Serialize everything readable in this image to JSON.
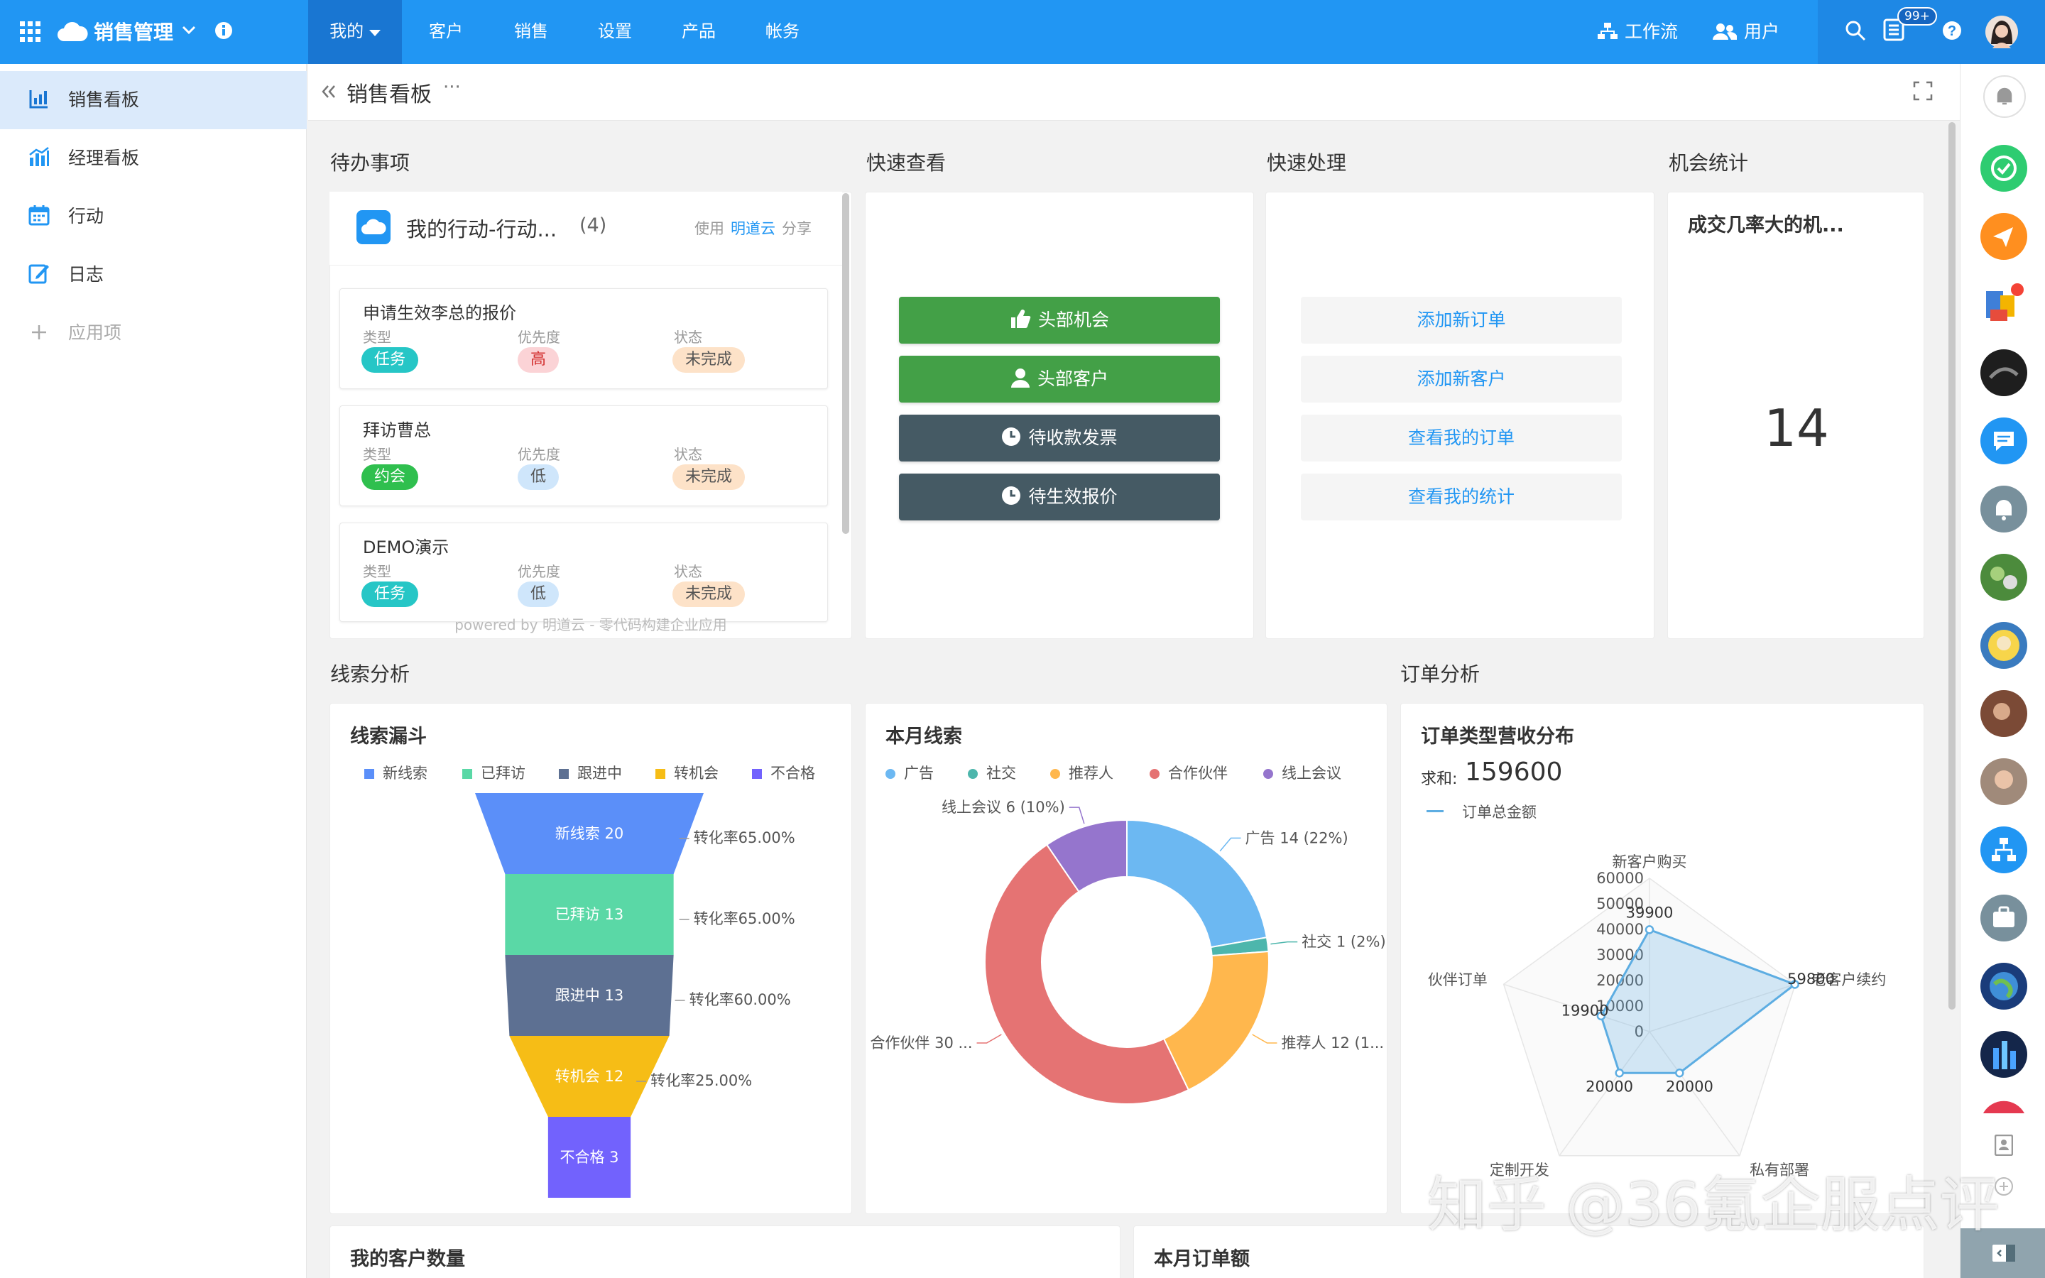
{
  "topbar": {
    "app_name": "销售管理",
    "nav": [
      "我的",
      "客户",
      "销售",
      "设置",
      "产品",
      "帐务"
    ],
    "workflow": "工作流",
    "users": "用户",
    "badge": "99+"
  },
  "sidebar": {
    "items": [
      "销售看板",
      "经理看板",
      "行动",
      "日志"
    ],
    "add_label": "应用项"
  },
  "page": {
    "title": "销售看板",
    "more": "···"
  },
  "todo": {
    "section": "待办事项",
    "card_title": "我的行动-行动...",
    "count": "(4)",
    "share_prefix": "使用",
    "share_brand": "明道云",
    "share_suffix": "分享",
    "labels": {
      "type": "类型",
      "priority": "优先度",
      "status": "状态"
    },
    "tasks": [
      {
        "title": "申请生效李总的报价",
        "type": "任务",
        "priority": "高",
        "status": "未完成"
      },
      {
        "title": "拜访曹总",
        "type": "约会",
        "priority": "低",
        "status": "未完成"
      },
      {
        "title": "DEMO演示",
        "type": "任务",
        "priority": "低",
        "status": "未完成"
      }
    ],
    "powered": "powered by 明道云 - 零代码构建企业应用"
  },
  "quick_view": {
    "section": "快速查看",
    "buttons": [
      "头部机会",
      "头部客户",
      "待收款发票",
      "待生效报价"
    ]
  },
  "quick_handle": {
    "section": "快速处理",
    "buttons": [
      "添加新订单",
      "添加新客户",
      "查看我的订单",
      "查看我的统计"
    ]
  },
  "opportunity": {
    "section": "机会统计",
    "card_title": "成交几率大的机...",
    "value": "14"
  },
  "lead_section": "线索分析",
  "order_section": "订单分析",
  "funnel": {
    "title": "线索漏斗",
    "legend": [
      "新线索",
      "已拜访",
      "跟进中",
      "转机会",
      "不合格"
    ],
    "colors": [
      "#5b8ff9",
      "#5ad8a6",
      "#5d7092",
      "#f6bd16",
      "#7262fd"
    ],
    "stage_labels": [
      "新线索 20",
      "已拜访 13",
      "跟进中 13",
      "转机会 12",
      "不合格 3"
    ],
    "rates": [
      "转化率65.00%",
      "转化率65.00%",
      "转化率60.00%",
      "转化率25.00%"
    ]
  },
  "donut": {
    "title": "本月线索",
    "legend": [
      "广告",
      "社交",
      "推荐人",
      "合作伙伴",
      "线上会议"
    ],
    "colors": [
      "#6cb8f2",
      "#4db6ac",
      "#ffb74d",
      "#e57373",
      "#9575cd"
    ],
    "slice_labels": [
      "广告  14 (22%)",
      "社交  1 (2%)",
      "推荐人  12 (1...",
      "合作伙伴  30 ...",
      "线上会议  6 (10%)"
    ]
  },
  "radar": {
    "title": "订单类型营收分布",
    "sum_label": "求和:",
    "sum_value": "159600",
    "legend": "订单总金额",
    "axes": [
      "新客户购买",
      "老客户续约",
      "私有部署",
      "定制开发",
      "伙伴订单"
    ],
    "ticks": [
      "60000",
      "50000",
      "40000",
      "30000",
      "20000",
      "10000",
      "0"
    ],
    "point_labels": [
      "39900",
      "59800",
      "20000",
      "20000",
      "19900"
    ]
  },
  "bottom": {
    "left_title": "我的客户数量",
    "right_title": "本月订单额"
  },
  "watermark": "知乎 @36氪企服点评",
  "chart_data": [
    {
      "type": "bar",
      "title": "线索漏斗",
      "categories": [
        "新线索",
        "已拜访",
        "跟进中",
        "转机会",
        "不合格"
      ],
      "values": [
        20,
        13,
        13,
        12,
        3
      ],
      "conversion_rates": [
        "65.00%",
        "65.00%",
        "60.00%",
        "25.00%"
      ]
    },
    {
      "type": "pie",
      "title": "本月线索",
      "categories": [
        "广告",
        "社交",
        "推荐人",
        "合作伙伴",
        "线上会议"
      ],
      "values": [
        14,
        1,
        12,
        30,
        6
      ],
      "legend": "top"
    },
    {
      "type": "line",
      "title": "订单类型营收分布",
      "categories": [
        "新客户购买",
        "老客户续约",
        "私有部署",
        "定制开发",
        "伙伴订单"
      ],
      "series": [
        {
          "name": "订单总金额",
          "values": [
            39900,
            59800,
            20000,
            20000,
            19900
          ]
        }
      ],
      "ylim": [
        0,
        60000
      ]
    }
  ]
}
